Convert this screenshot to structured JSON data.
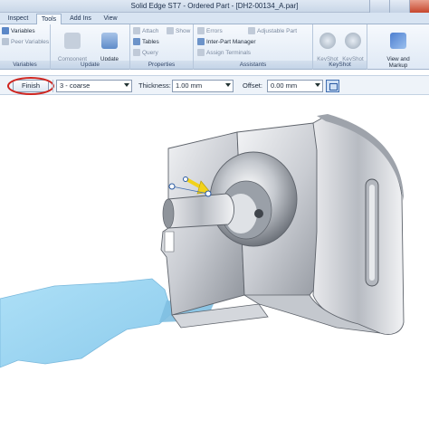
{
  "window": {
    "title": "Solid Edge ST7 - Ordered Part - [DH2-00134_A.par]"
  },
  "tabs": [
    "Inspect",
    "Tools",
    "Add Ins",
    "View"
  ],
  "active_tab": "Tools",
  "ribbon": {
    "variables_group": {
      "label": "Variables",
      "items": [
        "Variables",
        "Peer Variables"
      ]
    },
    "update_group": {
      "label": "Update",
      "component_tracker": "Component\nTracker",
      "update_active_level": "Update\nActive Level"
    },
    "properties_group": {
      "label": "Properties",
      "items": [
        "Attach",
        "Show",
        "Tables",
        "Query"
      ]
    },
    "assistants_group": {
      "label": "Assistants",
      "items": [
        "Errors",
        "Adjustable Part",
        "Inter-Part Manager",
        "Assign Terminals"
      ]
    },
    "keyshot_group": {
      "label": "KeyShot",
      "render": "KeyShot\nRender",
      "update": "KeyShot\nUpdate"
    },
    "view_markup": {
      "label": "View and\nMarkup"
    }
  },
  "command_bar": {
    "finish_label": "Finish",
    "mesh_option": "3 - coarse",
    "thickness_label": "Thickness:",
    "thickness_value": "1.00 mm",
    "offset_label": "Offset:",
    "offset_value": "0.00 mm"
  },
  "colors": {
    "accent": "#3f6db0",
    "highlight_ring": "#d0251f",
    "handle": "#f2d21b",
    "surface": "#9fd3f0"
  }
}
